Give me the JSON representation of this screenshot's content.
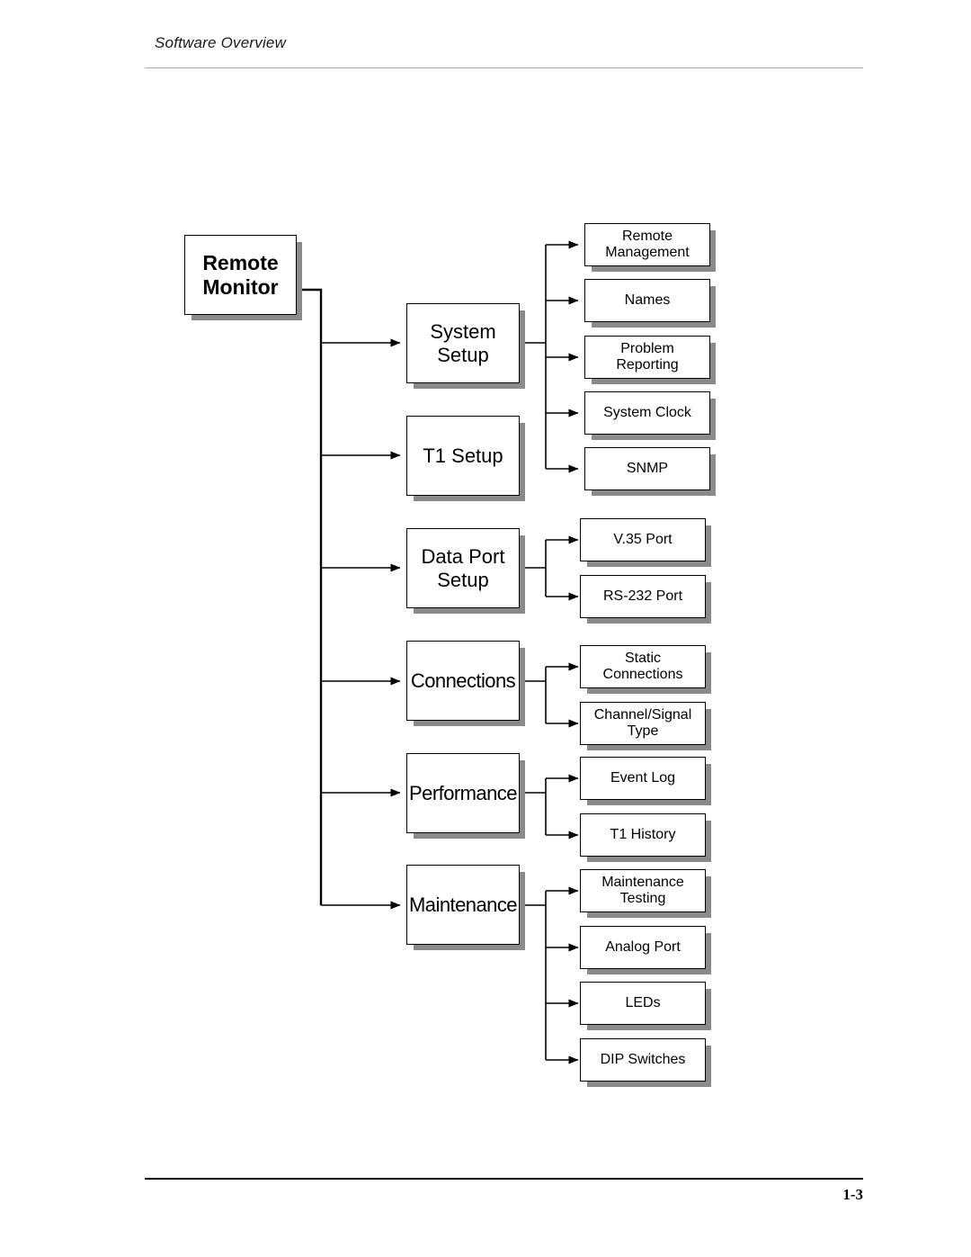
{
  "page": {
    "header_title": "Software Overview",
    "page_number": "1-3"
  },
  "diagram": {
    "type": "tree",
    "root": {
      "label": "Remote\nMonitor"
    },
    "level1": [
      {
        "label": "System\nSetup"
      },
      {
        "label": "T1 Setup"
      },
      {
        "label": "Data Port\nSetup"
      },
      {
        "label": "Connections"
      },
      {
        "label": "Performance"
      },
      {
        "label": "Maintenance"
      }
    ],
    "level2": [
      {
        "label": "Remote\nManagement",
        "parent": "System Setup"
      },
      {
        "label": "Names",
        "parent": "System Setup"
      },
      {
        "label": "Problem\nReporting",
        "parent": "System Setup"
      },
      {
        "label": "System Clock",
        "parent": "System Setup"
      },
      {
        "label": "SNMP",
        "parent": "System Setup"
      },
      {
        "label": "V.35 Port",
        "parent": "Data Port Setup"
      },
      {
        "label": "RS-232 Port",
        "parent": "Data Port Setup"
      },
      {
        "label": "Static\nConnections",
        "parent": "Connections"
      },
      {
        "label": "Channel/Signal\nType",
        "parent": "Connections"
      },
      {
        "label": "Event Log",
        "parent": "Performance"
      },
      {
        "label": "T1 History",
        "parent": "Performance"
      },
      {
        "label": "Maintenance\nTesting",
        "parent": "Maintenance"
      },
      {
        "label": "Analog Port",
        "parent": "Maintenance"
      },
      {
        "label": "LEDs",
        "parent": "Maintenance"
      },
      {
        "label": "DIP Switches",
        "parent": "Maintenance"
      }
    ],
    "colors": {
      "box_border": "#000000",
      "box_fill": "#ffffff",
      "box_shadow": "#8a8a8a",
      "connector": "#000000",
      "rule": "#a9a9a9"
    }
  }
}
